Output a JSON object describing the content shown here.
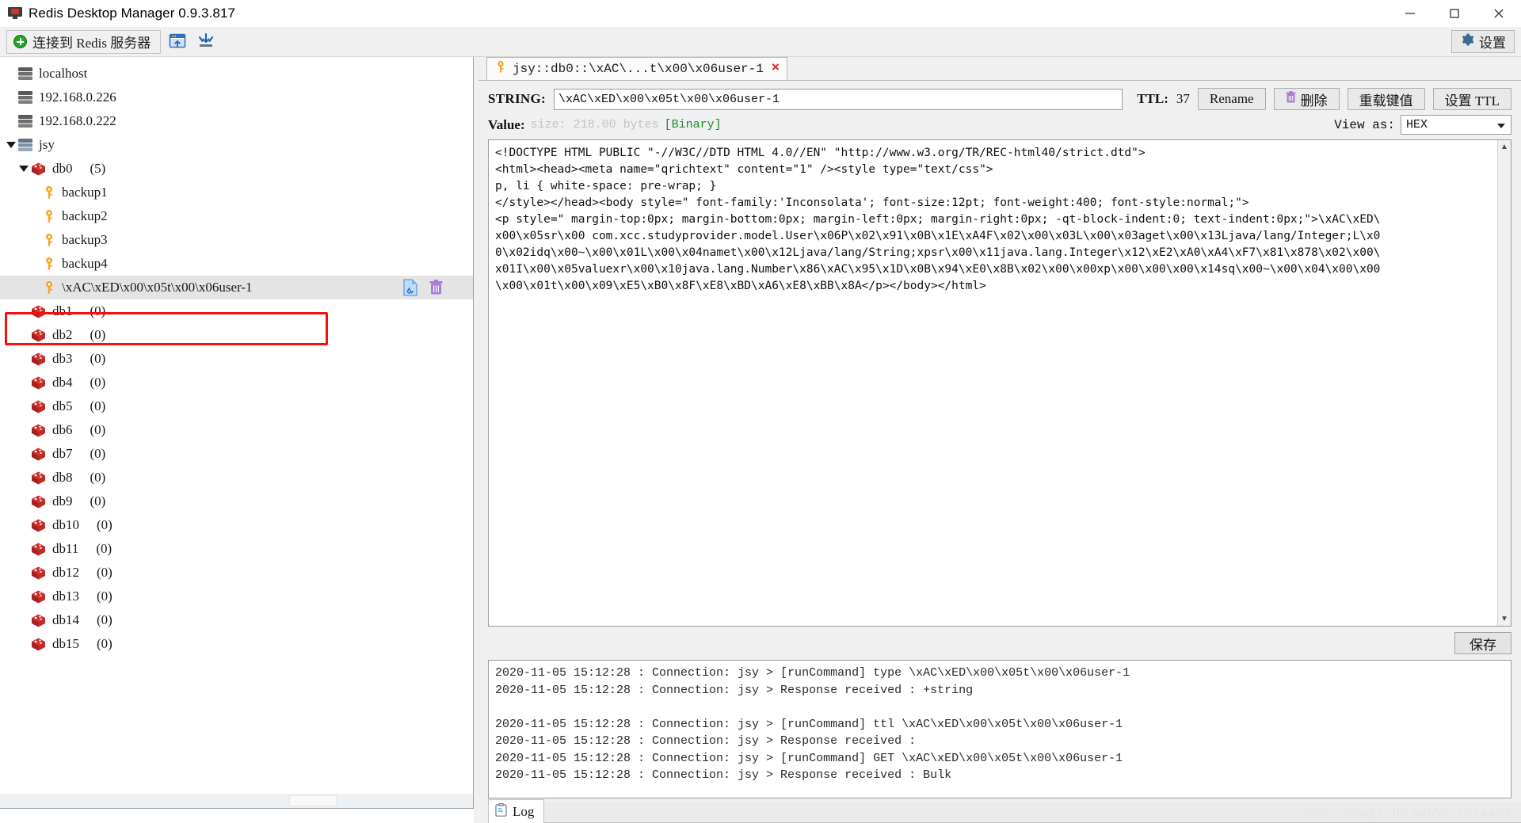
{
  "window": {
    "title": "Redis Desktop Manager 0.9.3.817",
    "icon": "app-monitor-icon",
    "controls": {
      "minimize": "minimize-icon",
      "maximize": "maximize-icon",
      "close": "close-icon"
    }
  },
  "toolbar": {
    "connect_label": "连接到 Redis 服务器",
    "import_icon": "import-connections-icon",
    "export_icon": "export-connections-icon",
    "settings_label": "设置",
    "settings_icon": "gear-icon"
  },
  "sidebar": {
    "items": [
      {
        "label": "localhost",
        "icon": "server-icon",
        "level": 1,
        "expander": "none",
        "type": "server"
      },
      {
        "label": "192.168.0.226",
        "icon": "server-icon",
        "level": 1,
        "expander": "none",
        "type": "server"
      },
      {
        "label": "192.168.0.222",
        "icon": "server-icon",
        "level": 1,
        "expander": "none",
        "type": "server"
      },
      {
        "label": "jsy",
        "icon": "server-icon",
        "level": 1,
        "expander": "expanded",
        "type": "server"
      },
      {
        "label": "db0",
        "count": "(5)",
        "icon": "database-icon",
        "level": 2,
        "expander": "expanded",
        "type": "db"
      },
      {
        "label": "backup1",
        "icon": "key-icon",
        "level": 3,
        "type": "key"
      },
      {
        "label": "backup2",
        "icon": "key-icon",
        "level": 3,
        "type": "key"
      },
      {
        "label": "backup3",
        "icon": "key-icon",
        "level": 3,
        "type": "key"
      },
      {
        "label": "backup4",
        "icon": "key-icon",
        "level": 3,
        "type": "key"
      },
      {
        "label": "\\xAC\\xED\\x00\\x05t\\x00\\x06user-1",
        "icon": "key-icon",
        "level": 3,
        "type": "key",
        "selected": true,
        "highlighted": true
      },
      {
        "label": "db1",
        "count": "(0)",
        "icon": "database-icon",
        "level": 2,
        "type": "db"
      },
      {
        "label": "db2",
        "count": "(0)",
        "icon": "database-icon",
        "level": 2,
        "type": "db"
      },
      {
        "label": "db3",
        "count": "(0)",
        "icon": "database-icon",
        "level": 2,
        "type": "db"
      },
      {
        "label": "db4",
        "count": "(0)",
        "icon": "database-icon",
        "level": 2,
        "type": "db"
      },
      {
        "label": "db5",
        "count": "(0)",
        "icon": "database-icon",
        "level": 2,
        "type": "db"
      },
      {
        "label": "db6",
        "count": "(0)",
        "icon": "database-icon",
        "level": 2,
        "type": "db"
      },
      {
        "label": "db7",
        "count": "(0)",
        "icon": "database-icon",
        "level": 2,
        "type": "db"
      },
      {
        "label": "db8",
        "count": "(0)",
        "icon": "database-icon",
        "level": 2,
        "type": "db"
      },
      {
        "label": "db9",
        "count": "(0)",
        "icon": "database-icon",
        "level": 2,
        "type": "db"
      },
      {
        "label": "db10",
        "count": "(0)",
        "icon": "database-icon",
        "level": 2,
        "type": "db"
      },
      {
        "label": "db11",
        "count": "(0)",
        "icon": "database-icon",
        "level": 2,
        "type": "db"
      },
      {
        "label": "db12",
        "count": "(0)",
        "icon": "database-icon",
        "level": 2,
        "type": "db"
      },
      {
        "label": "db13",
        "count": "(0)",
        "icon": "database-icon",
        "level": 2,
        "type": "db"
      },
      {
        "label": "db14",
        "count": "(0)",
        "icon": "database-icon",
        "level": 2,
        "type": "db"
      },
      {
        "label": "db15",
        "count": "(0)",
        "icon": "database-icon",
        "level": 2,
        "type": "db"
      }
    ],
    "row_actions": {
      "copy_icon": "copy-key-icon",
      "delete_icon": "delete-key-icon"
    },
    "highlight_color": "#f5100d"
  },
  "tab": {
    "icon": "key-icon",
    "title": "jsy::db0::\\xAC\\...t\\x00\\x06user-1",
    "close": "×"
  },
  "key_bar": {
    "type_label": "STRING:",
    "key_value": "\\xAC\\xED\\x00\\x05t\\x00\\x06user-1",
    "ttl_label": "TTL:",
    "ttl_value": "37",
    "rename_label": "Rename",
    "delete_label": "删除",
    "delete_icon": "trash-icon",
    "reload_label": "重载键值",
    "set_ttl_label": "设置 TTL"
  },
  "value_bar": {
    "value_label": "Value:",
    "size_text": "size: 218.00 bytes",
    "binary_text": "[Binary]",
    "view_as_label": "View as:",
    "view_as_value": "HEX"
  },
  "editor": {
    "lines": [
      "<!DOCTYPE HTML PUBLIC \"-//W3C//DTD HTML 4.0//EN\" \"http://www.w3.org/TR/REC-html40/strict.dtd\">",
      "<html><head><meta name=\"qrichtext\" content=\"1\" /><style type=\"text/css\">",
      "p, li { white-space: pre-wrap; }",
      "</style></head><body style=\" font-family:'Inconsolata'; font-size:12pt; font-weight:400; font-style:normal;\">",
      "<p style=\" margin-top:0px; margin-bottom:0px; margin-left:0px; margin-right:0px; -qt-block-indent:0; text-indent:0px;\">\\xAC\\xED\\",
      "x00\\x05sr\\x00 com.xcc.studyprovider.model.User\\x06P\\x02\\x91\\x0B\\x1E\\xA4F\\x02\\x00\\x03L\\x00\\x03aget\\x00\\x13Ljava/lang/Integer;L\\x0",
      "0\\x02idq\\x00~\\x00\\x01L\\x00\\x04namet\\x00\\x12Ljava/lang/String;xpsr\\x00\\x11java.lang.Integer\\x12\\xE2\\xA0\\xA4\\xF7\\x81\\x878\\x02\\x00\\",
      "x01I\\x00\\x05valuexr\\x00\\x10java.lang.Number\\x86\\xAC\\x95\\x1D\\x0B\\x94\\xE0\\x8B\\x02\\x00\\x00xp\\x00\\x00\\x00\\x14sq\\x00~\\x00\\x04\\x00\\x00",
      "\\x00\\x01t\\x00\\x09\\xE5\\xB0\\x8F\\xE8\\xBD\\xA6\\xE8\\xBB\\x8A</p></body></html>"
    ],
    "scroll_up": "scroll-up-arrow",
    "scroll_down": "scroll-down-arrow"
  },
  "save": {
    "label": "保存"
  },
  "log": {
    "lines": [
      "2020-11-05 15:12:28 : Connection: jsy > [runCommand] type \\xAC\\xED\\x00\\x05t\\x00\\x06user-1",
      "2020-11-05 15:12:28 : Connection: jsy > Response received : +string",
      "",
      "2020-11-05 15:12:28 : Connection: jsy > [runCommand] ttl \\xAC\\xED\\x00\\x05t\\x00\\x06user-1",
      "2020-11-05 15:12:28 : Connection: jsy > Response received :",
      "2020-11-05 15:12:28 : Connection: jsy > [runCommand] GET \\xAC\\xED\\x00\\x05t\\x00\\x06user-1",
      "2020-11-05 15:12:28 : Connection: jsy > Response received : Bulk"
    ],
    "tab_label": "Log",
    "tab_icon": "clipboard-icon"
  },
  "watermark": {
    "text": "https://blog.csdn.net/xcc1974494"
  }
}
